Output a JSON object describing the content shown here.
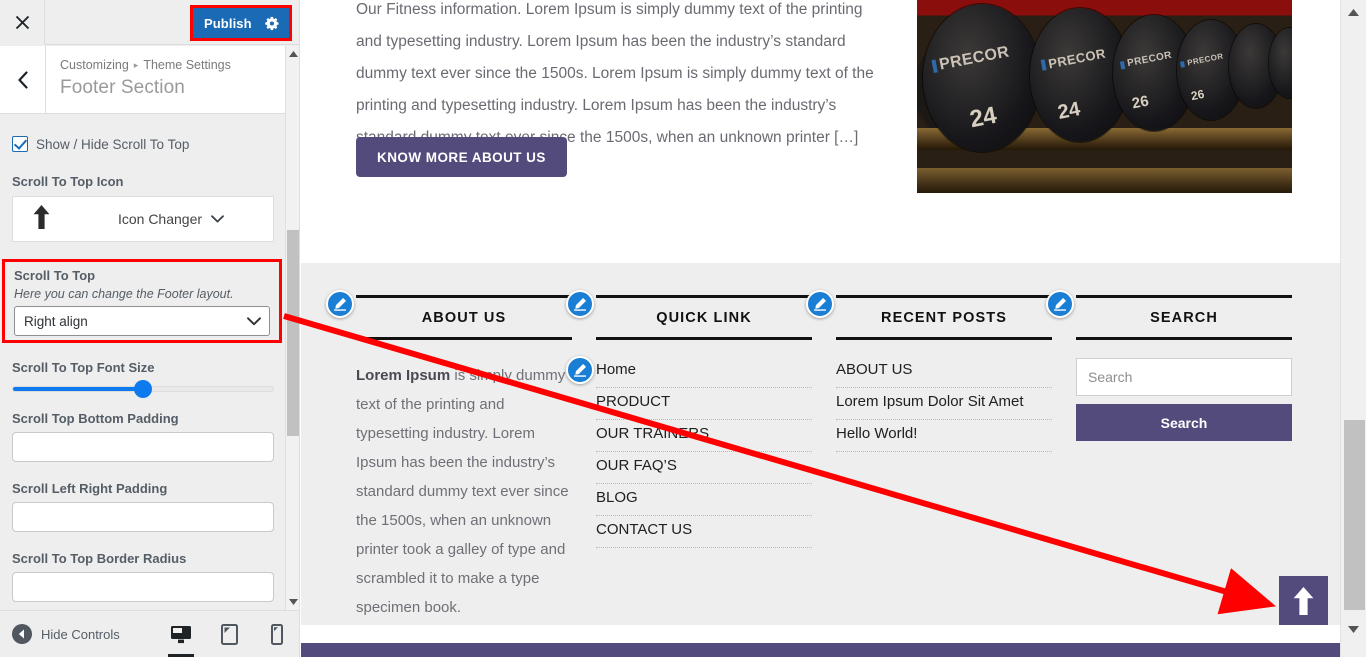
{
  "customizer": {
    "close_icon": "close-icon",
    "publish_label": "Publish",
    "gear_icon": "gear-icon",
    "back_icon": "chevron-left-icon",
    "breadcrumb_root": "Customizing",
    "breadcrumb_sep": "▸",
    "breadcrumb_parent": "Theme Settings",
    "panel_title": "Footer Section",
    "accent_blue": "#1a6ab5",
    "highlight_red": "#ff0000",
    "controls": {
      "show_hide_label": "Show / Hide Scroll To Top",
      "show_hide_checked": true,
      "icon_label": "Scroll To Top Icon",
      "icon_glyph": "⬆",
      "icon_changer_label": "Icon Changer",
      "chevron_icon": "chevron-down-icon",
      "group_title": "Scroll To Top",
      "group_desc": "Here you can change the Footer layout.",
      "layout_value": "Right align",
      "font_size_label": "Scroll To Top Font Size",
      "font_size_percent": 50,
      "bottom_padding_label": "Scroll Top Bottom Padding",
      "bottom_padding_value": "",
      "lr_padding_label": "Scroll Left Right Padding",
      "lr_padding_value": "",
      "border_radius_label": "Scroll To Top Border Radius",
      "border_radius_value": ""
    },
    "footer": {
      "hide_controls_label": "Hide Controls",
      "collapse_icon": "collapse-left-icon",
      "devices": [
        {
          "name": "desktop-preview-button",
          "icon": "desktop-icon",
          "active": true
        },
        {
          "name": "tablet-preview-button",
          "icon": "tablet-icon",
          "active": false
        },
        {
          "name": "mobile-preview-button",
          "icon": "mobile-icon",
          "active": false
        }
      ]
    }
  },
  "preview": {
    "about_paragraph": "Our Fitness information. Lorem Ipsum is simply dummy text of the printing and typesetting industry. Lorem Ipsum has been the industry’s standard dummy text ever since the 1500s. Lorem Ipsum is simply dummy text of the printing and typesetting industry. Lorem Ipsum has been the industry’s standard dummy text ever since the 1500s, when an unknown printer […]",
    "know_more_label": "KNOW MORE ABOUT US",
    "brand_purple": "#544b7d",
    "hero": {
      "alt": "gym-dumbbell-rack-image",
      "brand_text": "PRECOR",
      "weights": [
        "24",
        "24",
        "26",
        "26"
      ]
    },
    "footer_columns": [
      {
        "title": "ABOUT US",
        "type": "text",
        "lead": "Lorem Ipsum",
        "body": " is simply dummy text of the printing and typesetting industry. Lorem Ipsum has been the industry’s standard dummy text ever since the 1500s, when an unknown printer took a galley of type and scrambled it to make a type specimen book."
      },
      {
        "title": "QUICK LINK",
        "type": "links",
        "items": [
          "Home",
          "PRODUCT",
          "OUR TRAINERS",
          "OUR FAQ’S",
          "BLOG",
          "CONTACT US"
        ]
      },
      {
        "title": "RECENT POSTS",
        "type": "links",
        "items": [
          "ABOUT US",
          "Lorem Ipsum Dolor Sit Amet",
          "Hello World!"
        ]
      },
      {
        "title": "SEARCH",
        "type": "search",
        "placeholder": "Search",
        "value": "",
        "button_label": "Search"
      }
    ],
    "edit_pin_icon": "pencil-edit-icon",
    "scroll_top_icon": "arrow-up-icon"
  },
  "annotation": {
    "color": "#ff0000",
    "from": "scroll-to-top-layout-select",
    "to": "scroll-to-top-button"
  }
}
